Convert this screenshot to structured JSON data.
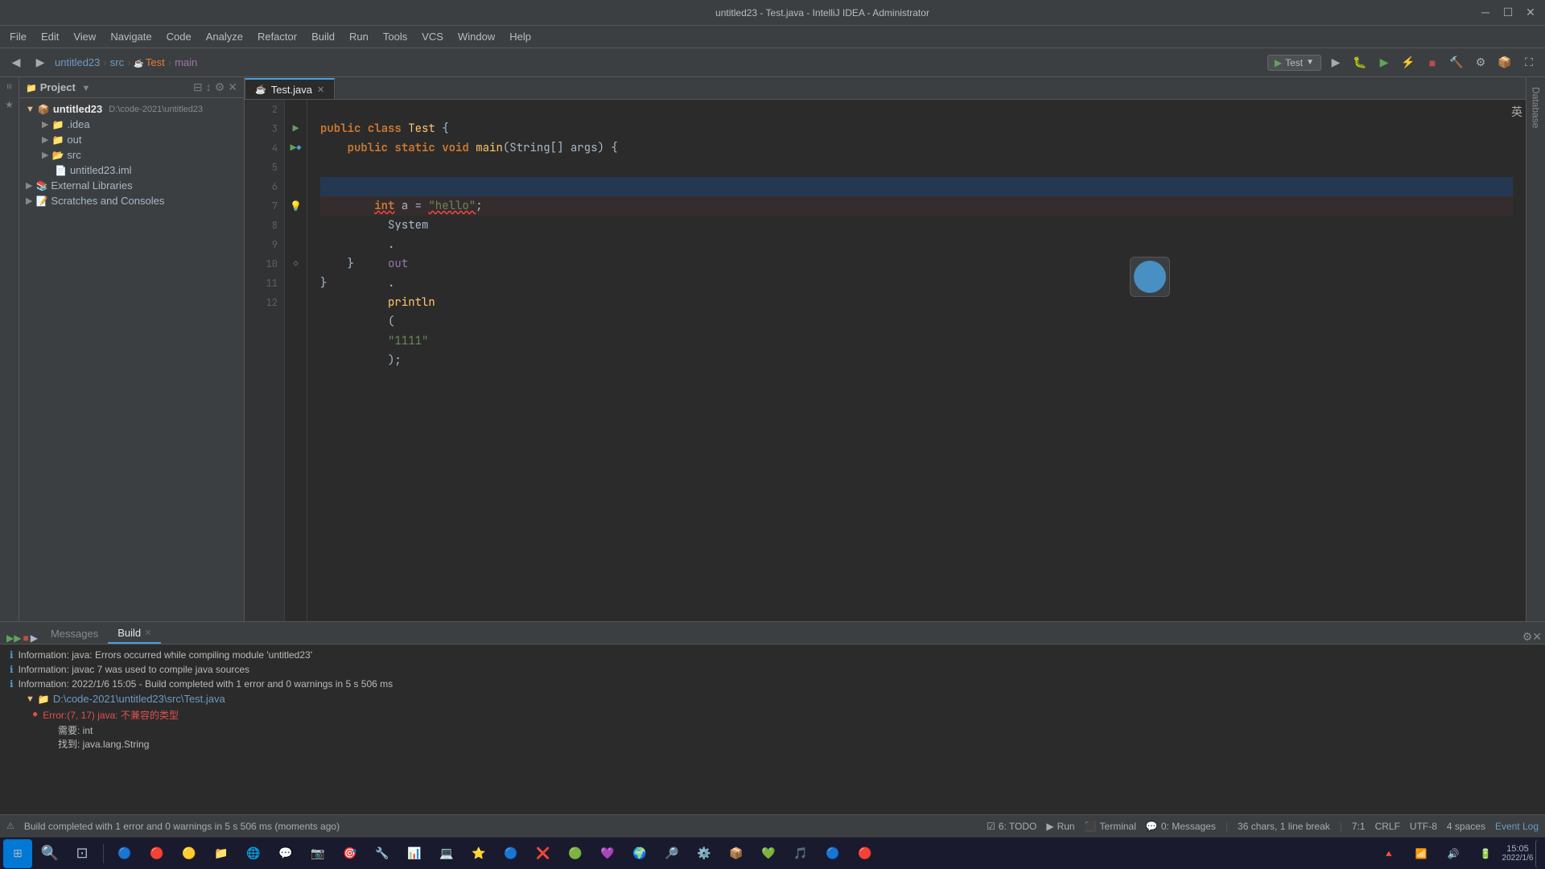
{
  "window": {
    "title": "untitled23 - Test.java - IntelliJ IDEA - Administrator",
    "controls": [
      "─",
      "☐",
      "✕"
    ]
  },
  "menubar": {
    "items": [
      "File",
      "Edit",
      "View",
      "Navigate",
      "Code",
      "Analyze",
      "Refactor",
      "Build",
      "Run",
      "Tools",
      "VCS",
      "Window",
      "Help"
    ]
  },
  "toolbar": {
    "breadcrumb": {
      "project": "untitled23",
      "src": "src",
      "class": "Test",
      "method": "main"
    },
    "run_config": "Test",
    "nav_back": "◀",
    "nav_fwd": "▶"
  },
  "project_panel": {
    "title": "Project",
    "items": [
      {
        "label": "untitled23",
        "path": "D:\\code-2021\\untitled23",
        "indent": 0,
        "type": "module",
        "expanded": true
      },
      {
        "label": ".idea",
        "indent": 1,
        "type": "folder"
      },
      {
        "label": "out",
        "indent": 1,
        "type": "folder"
      },
      {
        "label": "src",
        "indent": 1,
        "type": "folder",
        "expanded": true
      },
      {
        "label": "untitled23.iml",
        "indent": 2,
        "type": "file"
      },
      {
        "label": "External Libraries",
        "indent": 0,
        "type": "folder"
      },
      {
        "label": "Scratches and Consoles",
        "indent": 0,
        "type": "folder"
      }
    ]
  },
  "editor": {
    "tab_label": "Test.java",
    "lines": [
      {
        "num": 2,
        "content": ""
      },
      {
        "num": 3,
        "content": "public class Test {",
        "has_run": true
      },
      {
        "num": 4,
        "content": "    public static void main(String[] args) {",
        "has_run": true
      },
      {
        "num": 5,
        "content": ""
      },
      {
        "num": 6,
        "content": "        System.out.println(\"1111\");",
        "highlighted": true
      },
      {
        "num": 7,
        "content": "        int a = \"hello\";",
        "error": true
      },
      {
        "num": 8,
        "content": ""
      },
      {
        "num": 9,
        "content": ""
      },
      {
        "num": 10,
        "content": "    }"
      },
      {
        "num": 11,
        "content": "}"
      },
      {
        "num": 12,
        "content": ""
      }
    ]
  },
  "messages_panel": {
    "tabs": [
      "Messages",
      "Build"
    ],
    "active_tab": "Build",
    "items": [
      {
        "type": "info",
        "text": "Information: java: Errors occurred while compiling module 'untitled23'"
      },
      {
        "type": "info",
        "text": "Information: javac 7 was used to compile java sources"
      },
      {
        "type": "info",
        "text": "Information: 2022/1/6 15:05 - Build completed with 1 error and 0 warnings in 5 s 506 ms"
      },
      {
        "type": "path",
        "text": "D:\\code-2021\\untitled23\\src\\Test.java"
      },
      {
        "type": "error",
        "text": "Error:(7, 17)  java: 不兼容的类型"
      },
      {
        "type": "indent",
        "text": "需要: int"
      },
      {
        "type": "indent",
        "text": "找到:  java.lang.String"
      }
    ]
  },
  "statusbar": {
    "build_status": "Build completed with 1 error and 0 warnings in 5 s 506 ms (moments ago)",
    "position": "7:1",
    "line_ending": "CRLF",
    "encoding": "UTF-8",
    "indent": "4 spaces",
    "char_info": "36 chars, 1 line break",
    "todo": "6: TODO",
    "run": "Run",
    "terminal": "Terminal",
    "messages": "0: Messages",
    "event_log": "Event Log"
  },
  "bottom_tools": {
    "items": [
      "▶▶",
      "■",
      "▶"
    ]
  },
  "ai_badge": "英",
  "taskbar_icons": [
    "⊞",
    "🔵",
    "📁",
    "💬",
    "🌐",
    "📂",
    "🎵",
    "📷",
    "🔧",
    "📊",
    "🎯",
    "🔍",
    "❌",
    "🔔",
    "🎨",
    "🎮",
    "🌍",
    "🔎",
    "⚙️",
    "📦",
    "💚",
    "💜",
    "🔵",
    "🔴",
    "🎯",
    "⭐",
    "🔵",
    "🔴"
  ]
}
